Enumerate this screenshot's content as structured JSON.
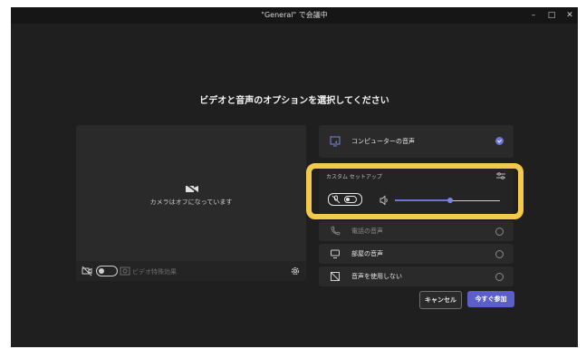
{
  "window": {
    "title": "\"General\" で会議中",
    "controls": {
      "minimize": "–",
      "maximize": "□",
      "close": "✕"
    }
  },
  "heading": "ビデオと音声のオプションを選択してください",
  "video": {
    "camera_off_text": "カメラはオフになっています",
    "effects_label": "ビデオ特殊効果",
    "camera_toggle": "off",
    "icons": {
      "camera_off": "camera-off-icon",
      "camera": "camera-icon",
      "effects": "effects-icon",
      "settings": "gear-icon"
    }
  },
  "audio": {
    "options": [
      {
        "label": "コンピューターの音声",
        "icon": "computer-audio-icon",
        "selected": true
      },
      {
        "label": "電話の音声",
        "icon": "phone-icon",
        "selected": false
      },
      {
        "label": "部屋の音声",
        "icon": "room-icon",
        "selected": false
      },
      {
        "label": "音声を使用しない",
        "icon": "no-audio-icon",
        "selected": false
      }
    ],
    "custom_setup_label": "カスタム セットアップ",
    "mic_toggle": "off",
    "volume_percent": 0.53,
    "highlight_color": "#f2c94c"
  },
  "buttons": {
    "cancel": "キャンセル",
    "join": "今すぐ参加"
  },
  "colors": {
    "accent": "#5b5fc7",
    "background": "#1f1f1f"
  }
}
